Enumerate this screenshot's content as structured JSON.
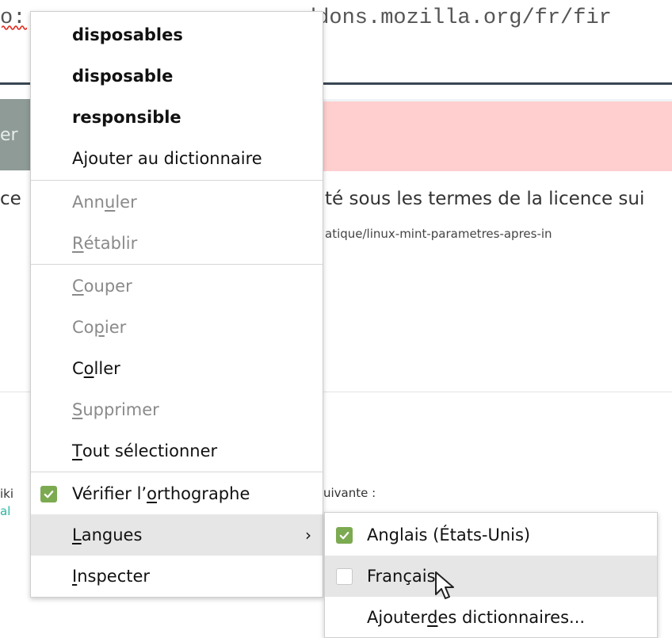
{
  "background": {
    "url_prefix": "o:",
    "url_main": "ddons.mozilla.org/fr/fir",
    "gray_block_text": "er",
    "license_left": "ce",
    "license_text": "té sous les termes de la licence sui",
    "url_small": "atique/linux-mint-parametres-apres-in",
    "wiki_left": "iki",
    "al_left": "al",
    "suivante": "uivante :"
  },
  "context_menu": {
    "suggestions": [
      "disposables",
      "disposable",
      "responsible"
    ],
    "add_to_dictionary": "Ajouter au dictionnaire",
    "undo": {
      "before": "Ann",
      "key": "u",
      "after": "ler"
    },
    "redo": {
      "before": "",
      "key": "R",
      "after": "établir"
    },
    "cut": {
      "before": "",
      "key": "C",
      "after": "ouper"
    },
    "copy": {
      "before": "Co",
      "key": "p",
      "after": "ier"
    },
    "paste": {
      "before": "C",
      "key": "o",
      "after": "ller"
    },
    "delete": {
      "before": "",
      "key": "S",
      "after": "upprimer"
    },
    "select_all": {
      "before": "",
      "key": "T",
      "after": "out sélectionner"
    },
    "spellcheck": {
      "before": "Vérifier l’",
      "key": "o",
      "after": "rthographe",
      "checked": true
    },
    "languages": {
      "before": "",
      "key": "L",
      "after": "angues",
      "arrow": "›"
    },
    "inspect": {
      "before": "",
      "key": "I",
      "after": "nspecter"
    }
  },
  "languages_submenu": {
    "english": {
      "label": "Anglais (États-Unis)",
      "checked": true
    },
    "french": {
      "label": "Français",
      "checked": false
    },
    "add_dictionaries": {
      "before": "Ajouter ",
      "key": "d",
      "after": "es dictionnaires..."
    }
  },
  "colors": {
    "check_green": "#7caa51",
    "pink_bar": "#ffcfcf",
    "hover_gray": "#e6e6e6"
  }
}
